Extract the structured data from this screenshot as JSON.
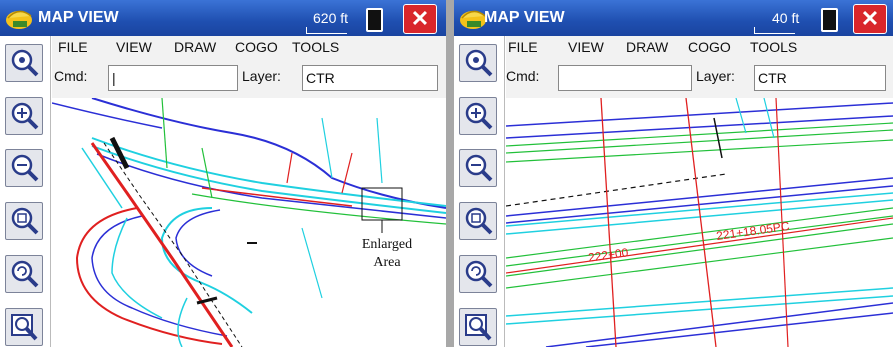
{
  "left_pane": {
    "title": "MAP VIEW",
    "scale": "620 ft",
    "close_label": "✕",
    "menu": [
      "FILE",
      "VIEW",
      "DRAW",
      "COGO",
      "TOOLS"
    ],
    "cmd_label": "Cmd:",
    "cmd_value": "|",
    "layer_label": "Layer:",
    "layer_value": "CTR",
    "annotation": [
      "Enlarged",
      "Area"
    ]
  },
  "right_pane": {
    "title": "MAP VIEW",
    "scale": "40 ft",
    "close_label": "✕",
    "menu": [
      "FILE",
      "VIEW",
      "DRAW",
      "COGO",
      "TOOLS"
    ],
    "cmd_label": "Cmd:",
    "cmd_value": "",
    "layer_label": "Layer:",
    "layer_value": "CTR",
    "station_labels": [
      "222+00",
      "221+18.05PC"
    ]
  },
  "toolbar_icons": [
    "zoom-extents-icon",
    "zoom-in-icon",
    "zoom-out-icon",
    "zoom-window-icon",
    "zoom-previous-icon",
    "zoom-realtime-icon"
  ],
  "colors": {
    "titlebar": "#1f4fb0",
    "close": "#d9262b",
    "blue_line": "#2b2fd6",
    "cyan_line": "#1fd0e0",
    "green_line": "#22c03a",
    "red_line": "#e02020"
  }
}
